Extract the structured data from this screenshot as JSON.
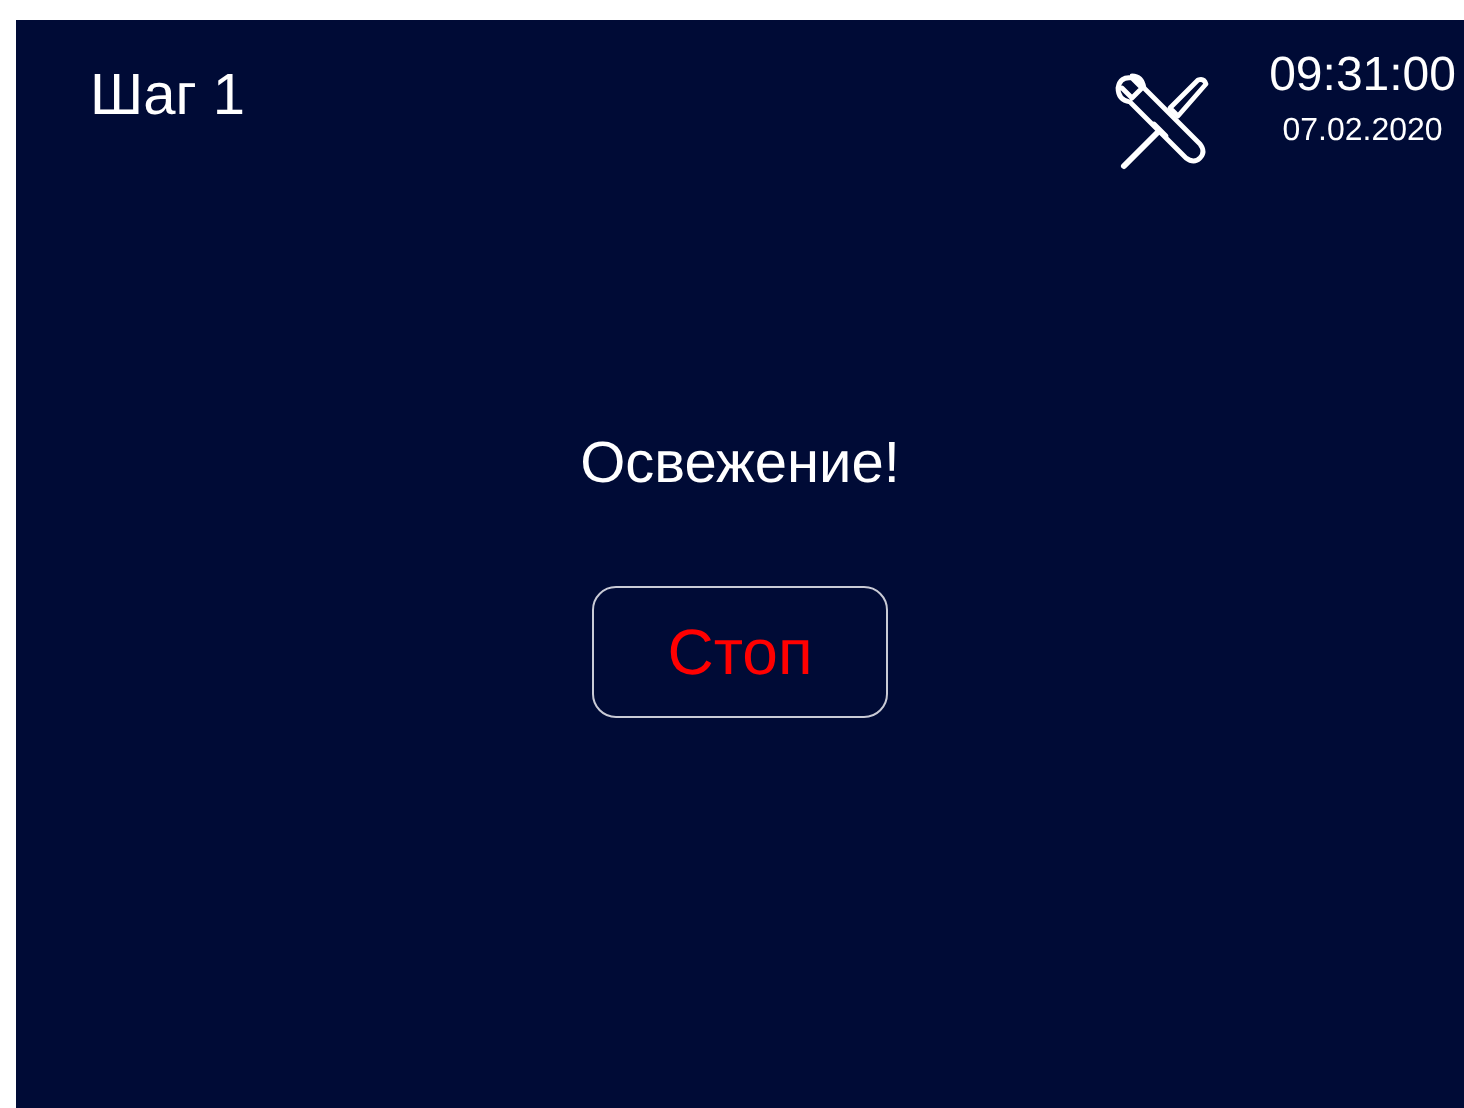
{
  "header": {
    "title": "Шаг 1",
    "time": "09:31:00",
    "date": "07.02.2020"
  },
  "message": "Освежение!",
  "button": {
    "label": "Стоп"
  }
}
